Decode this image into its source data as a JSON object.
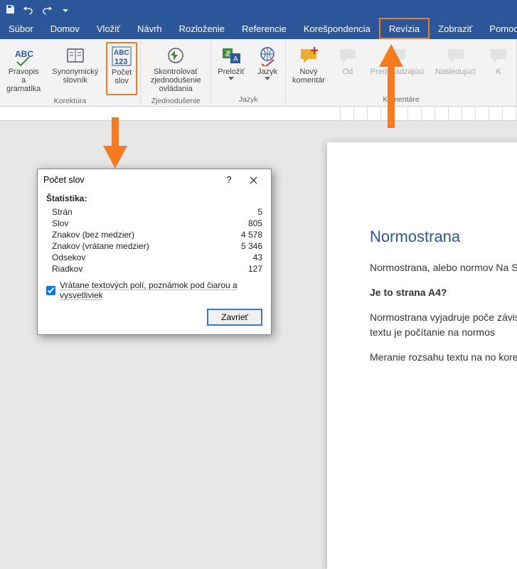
{
  "menu": {
    "items": [
      "Súbor",
      "Domov",
      "Vložiť",
      "Návrh",
      "Rozloženie",
      "Referencie",
      "Korešpondencia",
      "Revízia",
      "Zobraziť",
      "Pomocník"
    ],
    "active": "Revízia"
  },
  "ribbon": {
    "groups": [
      {
        "label": "Korektúra",
        "buttons": [
          {
            "name": "pravopis",
            "l1": "Pravopis a",
            "l2": "gramatika"
          },
          {
            "name": "slovnik",
            "l1": "Synonymický",
            "l2": "slovník"
          },
          {
            "name": "pocet-slov",
            "l1": "Počet",
            "l2": "slov",
            "highlight": true
          }
        ]
      },
      {
        "label": "Zjednodušenie ovládania",
        "buttons": [
          {
            "name": "skontrolovat",
            "l1": "Skontrolovať",
            "l2": "zjednodušenie ovládania"
          }
        ]
      },
      {
        "label": "Jazyk",
        "buttons": [
          {
            "name": "prelozit",
            "l1": "Preložiť",
            "l2": "",
            "dd": true
          },
          {
            "name": "jazyk",
            "l1": "Jazyk",
            "l2": "",
            "dd": true
          }
        ]
      },
      {
        "label": "Komentáre",
        "buttons": [
          {
            "name": "novy-komentar",
            "l1": "Nový",
            "l2": "komentár"
          },
          {
            "name": "odstranit",
            "l1": "Od",
            "l2": "",
            "dim": true
          },
          {
            "name": "predchadzajuci",
            "l1": "Predchádzajúci",
            "l2": "",
            "dim": true
          },
          {
            "name": "nasledujuci",
            "l1": "Nasledujúci",
            "l2": "",
            "dim": true
          },
          {
            "name": "zobrazit-komentare",
            "l1": "K",
            "l2": "",
            "dim": true
          }
        ]
      }
    ]
  },
  "dialog": {
    "title": "Počet slov",
    "stat_head": "Štatistika:",
    "rows": [
      {
        "k": "Strán",
        "v": "5"
      },
      {
        "k": "Slov",
        "v": "805"
      },
      {
        "k": "Znakov (bez medzier)",
        "v": "4 578"
      },
      {
        "k": "Znakov (vrátane medzier)",
        "v": "5 346"
      },
      {
        "k": "Odsekov",
        "v": "43"
      },
      {
        "k": "Riadkov",
        "v": "127"
      }
    ],
    "checkbox": "Vrátane textových polí, poznámok pod čiarou a vysvetliviek",
    "close": "Zavrieť"
  },
  "doc": {
    "h": "Normostrana",
    "p1": "Normostrana, alebo normov Na Slovensku a v Česku sa za",
    "p2h": "Je to strana A4?",
    "p2": "Normostrana vyjadruje poče závislosti od typu a veľkosti p textu je počítanie na normos",
    "p3": "Meranie rozsahu textu na no korektúrach textu alebo pri o"
  }
}
